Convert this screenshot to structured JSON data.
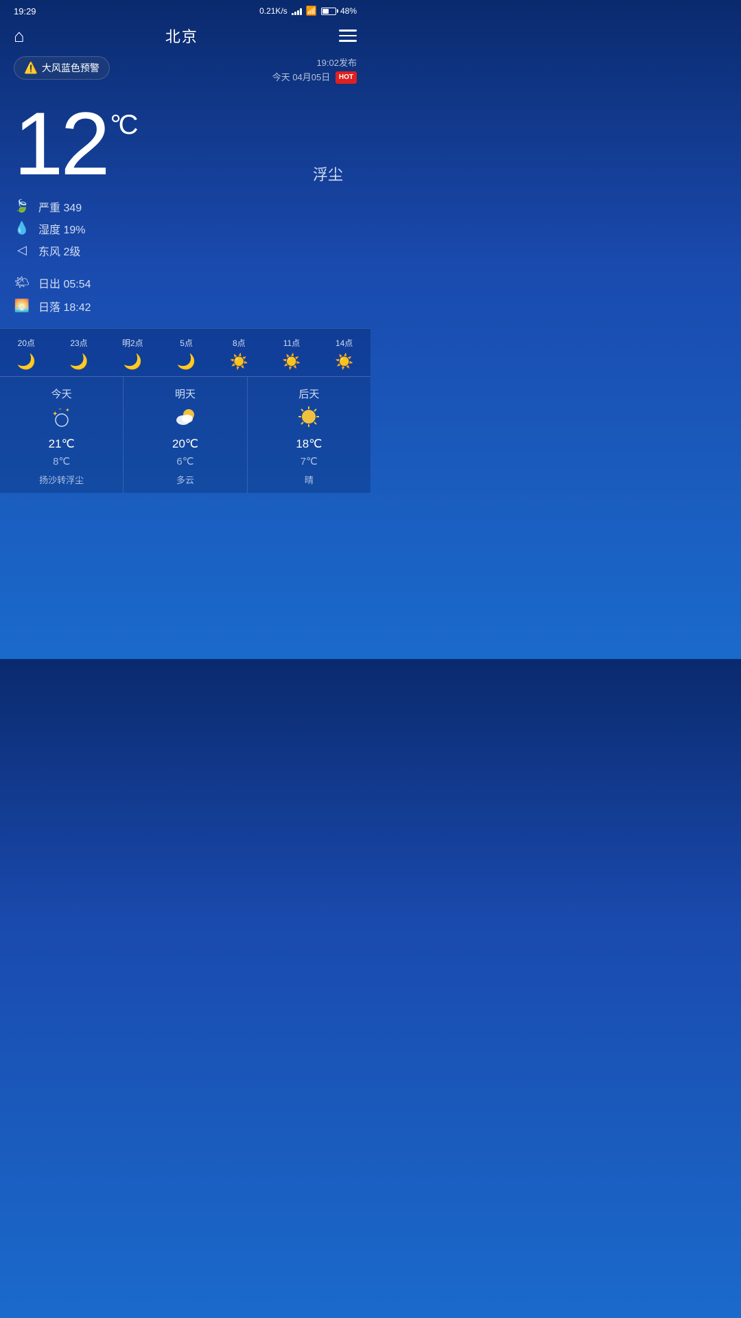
{
  "statusBar": {
    "time": "19:29",
    "speed": "0.21K/s",
    "battery": "48%"
  },
  "header": {
    "city": "北京",
    "homeIcon": "⌂",
    "menuIcon": "≡"
  },
  "alert": {
    "badge": "⚠️ 大风蓝色预警",
    "publishTime": "19:02发布",
    "date": "今天 04月05日",
    "hotLabel": "HOT"
  },
  "current": {
    "temperature": "12",
    "unit": "°C",
    "description": "浮尘",
    "aqi_label": "严重",
    "aqi_value": "349",
    "humidity_label": "湿度",
    "humidity_value": "19%",
    "wind_label": "东风 2级",
    "sunrise_label": "日出",
    "sunrise_time": "05:54",
    "sunset_label": "日落",
    "sunset_time": "18:42"
  },
  "hourly": [
    {
      "time": "20点",
      "icon": "moon",
      "phase": "🌙"
    },
    {
      "time": "23点",
      "icon": "moon",
      "phase": "🌙"
    },
    {
      "time": "明2点",
      "icon": "moon",
      "phase": "🌙"
    },
    {
      "time": "5点",
      "icon": "moon",
      "phase": "🌙"
    },
    {
      "time": "8点",
      "icon": "sun",
      "phase": "☀️"
    },
    {
      "time": "11点",
      "icon": "sun",
      "phase": "☀️"
    },
    {
      "time": "14点",
      "icon": "sun",
      "phase": "☀️"
    }
  ],
  "daily": [
    {
      "label": "今天",
      "icon": "⛅",
      "iconType": "haze-stars",
      "high": "21℃",
      "low": "8℃",
      "desc": "扬沙转浮尘"
    },
    {
      "label": "明天",
      "icon": "⛅",
      "iconType": "partly-cloudy",
      "high": "20℃",
      "low": "6℃",
      "desc": "多云"
    },
    {
      "label": "后天",
      "icon": "☀️",
      "iconType": "sunny",
      "high": "18℃",
      "low": "7℃",
      "desc": "晴"
    }
  ]
}
